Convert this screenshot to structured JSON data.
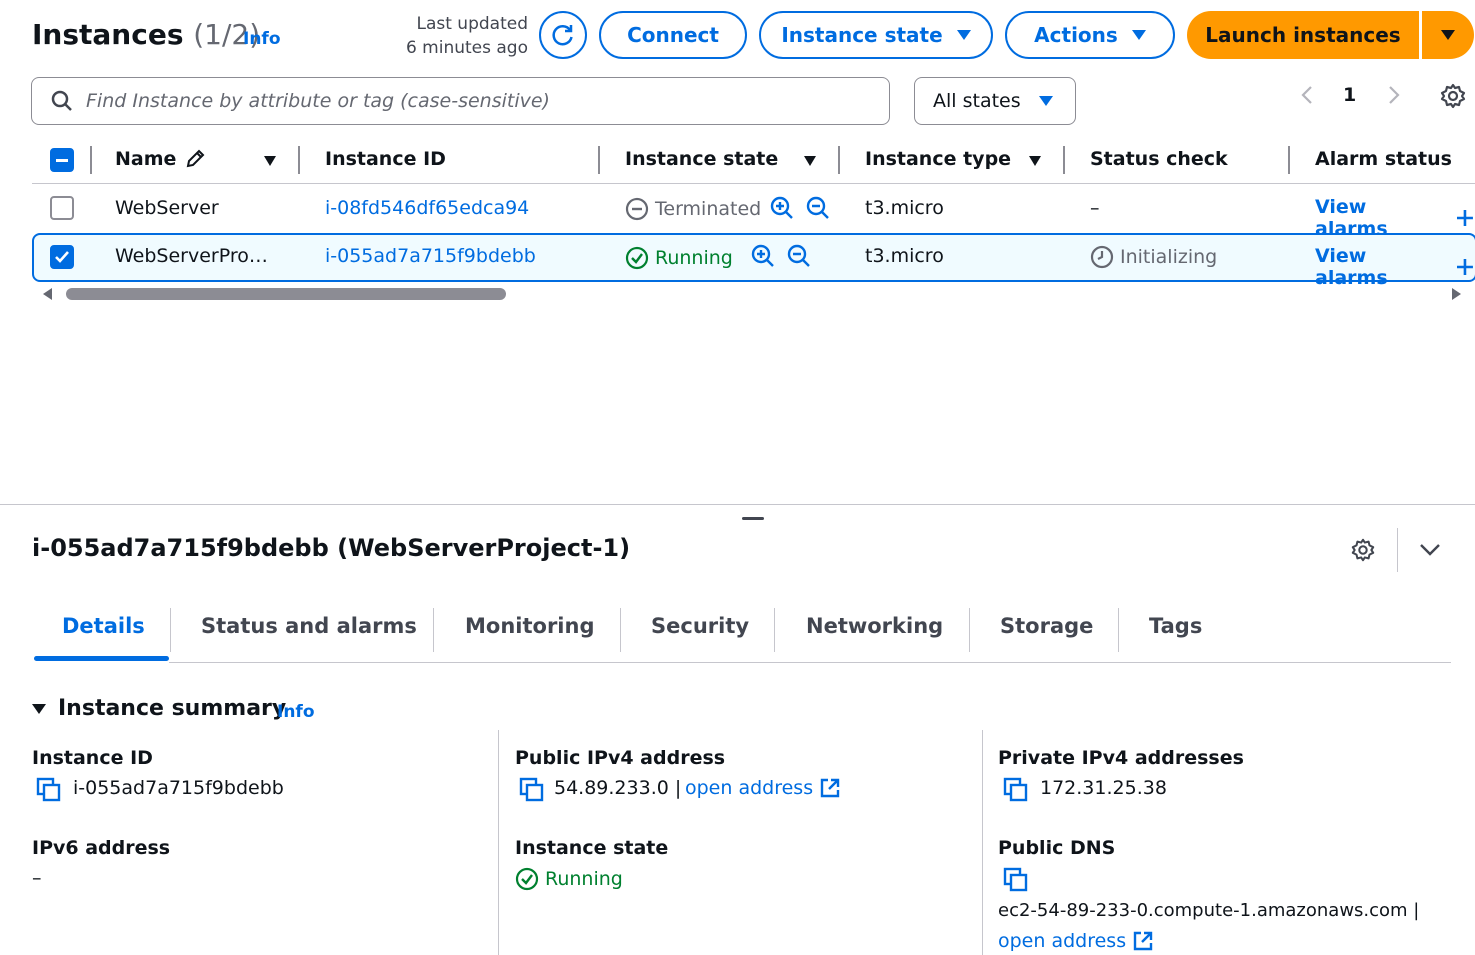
{
  "header": {
    "title": "Instances",
    "count": "(1/2)",
    "info": "Info",
    "last_updated_line1": "Last updated",
    "last_updated_line2": "6 minutes ago",
    "connect": "Connect",
    "instance_state": "Instance state",
    "actions": "Actions",
    "launch": "Launch instances"
  },
  "search": {
    "placeholder": "Find Instance by attribute or tag (case-sensitive)",
    "filter": "All states"
  },
  "pagination": {
    "page": "1"
  },
  "table": {
    "columns": [
      "Name",
      "Instance ID",
      "Instance state",
      "Instance type",
      "Status check",
      "Alarm status"
    ],
    "rows": [
      {
        "name": "WebServer",
        "id": "i-08fd546df65edca94",
        "state": "Terminated",
        "type": "t3.micro",
        "status": "–",
        "alarm": "View alarms",
        "selected": false
      },
      {
        "name": "WebServerPro…",
        "id": "i-055ad7a715f9bdebb",
        "state": "Running",
        "type": "t3.micro",
        "status": "Initializing",
        "alarm": "View alarms",
        "selected": true
      }
    ]
  },
  "detail": {
    "title": "i-055ad7a715f9bdebb (WebServerProject-1)",
    "tabs": [
      "Details",
      "Status and alarms",
      "Monitoring",
      "Security",
      "Networking",
      "Storage",
      "Tags"
    ],
    "section_title": "Instance summary",
    "section_info": "Info",
    "instance_id_label": "Instance ID",
    "instance_id_value": "i-055ad7a715f9bdebb",
    "public_ipv4_label": "Public IPv4 address",
    "public_ipv4_value": "54.89.233.0 |",
    "open_address": "open address",
    "private_ipv4_label": "Private IPv4 addresses",
    "private_ipv4_value": "172.31.25.38",
    "ipv6_label": "IPv6 address",
    "ipv6_value": "–",
    "instance_state_label": "Instance state",
    "instance_state_value": "Running",
    "public_dns_label": "Public DNS",
    "public_dns_value": "ec2-54-89-233-0.compute-1.amazonaws.com |",
    "public_dns_open": "open address"
  },
  "colors": {
    "accent": "#006ce0",
    "launch": "#ff9900",
    "running": "#00802f",
    "selected_row": "#f0fbff"
  }
}
